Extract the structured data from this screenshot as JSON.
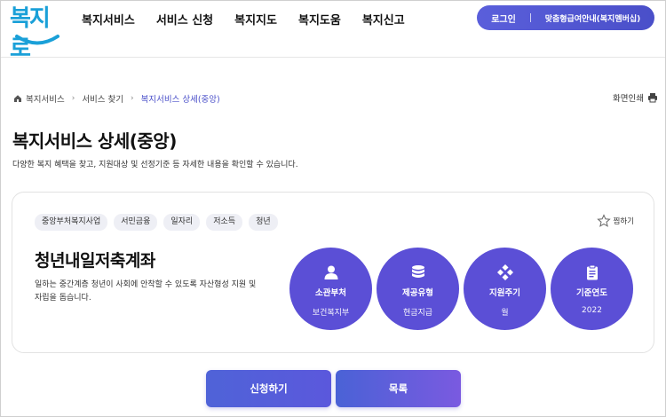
{
  "logo": {
    "text": "복지로"
  },
  "nav": {
    "items": [
      "복지서비스",
      "서비스 신청",
      "복지지도",
      "복지도움",
      "복지신고"
    ]
  },
  "top_buttons": {
    "login": "로그인",
    "guide": "맞춤형급여안내(복지멤버십)"
  },
  "breadcrumb": {
    "items": [
      "복지서비스",
      "서비스 찾기",
      "복지서비스 상세(중앙)"
    ]
  },
  "print_label": "화면인쇄",
  "page": {
    "title": "복지서비스 상세(중앙)",
    "description": "다양한 복지 혜택을 찾고, 지원대상 및 선정기준 등 자세한 내용을 확인할 수 있습니다."
  },
  "service": {
    "tags": [
      "중앙부처복지사업",
      "서민금융",
      "일자리",
      "저소득",
      "청년"
    ],
    "favorite_label": "찜하기",
    "title": "청년내일저축계좌",
    "description": "일하는 중간계층 청년이 사회에 안착할 수 있도록 자산형성 지원 및 자립을 돕습니다.",
    "info": [
      {
        "label": "소관부처",
        "value": "보건복지부",
        "icon": "person-icon"
      },
      {
        "label": "제공유형",
        "value": "현금지급",
        "icon": "coins-icon"
      },
      {
        "label": "지원주기",
        "value": "월",
        "icon": "diamond-dots-icon"
      },
      {
        "label": "기준연도",
        "value": "2022",
        "icon": "clipboard-icon"
      }
    ]
  },
  "buttons": {
    "apply": "신청하기",
    "list": "목록"
  },
  "colors": {
    "accent": "#5b4fd6",
    "logo": "#1aa0d8"
  }
}
